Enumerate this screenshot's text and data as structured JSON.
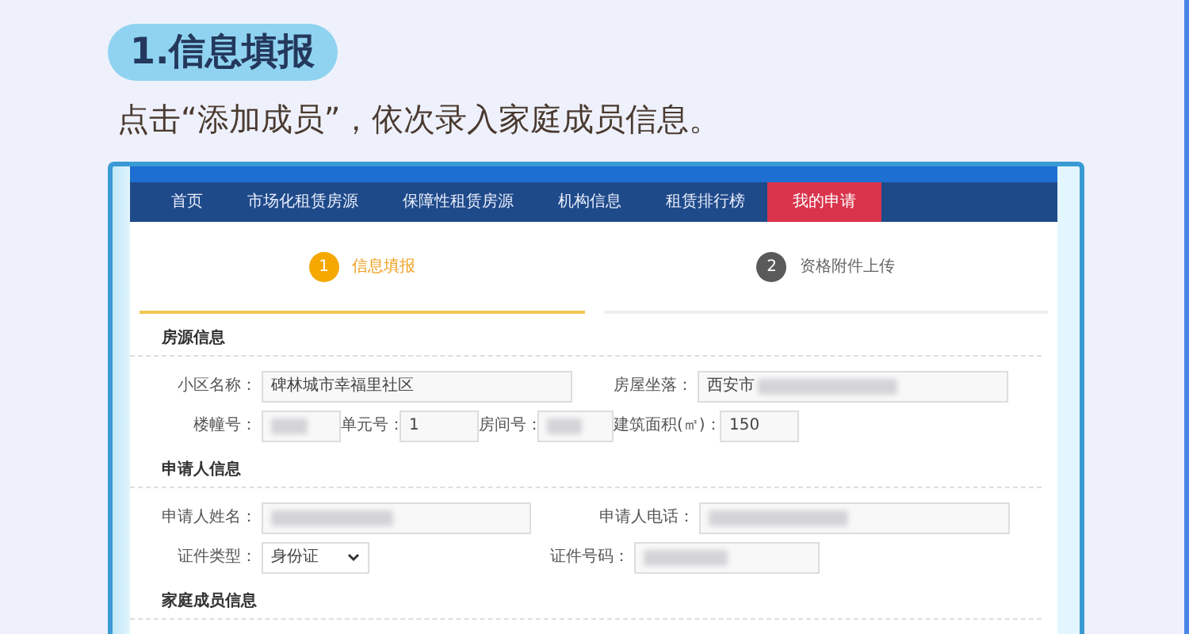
{
  "heading": {
    "label": "1.信息填报"
  },
  "instruction": "点击“添加成员”，依次录入家庭成员信息。",
  "nav": [
    {
      "label": "首页",
      "selected": false
    },
    {
      "label": "市场化租赁房源",
      "selected": false
    },
    {
      "label": "保障性租赁房源",
      "selected": false
    },
    {
      "label": "机构信息",
      "selected": false
    },
    {
      "label": "租赁排行榜",
      "selected": false
    },
    {
      "label": "我的申请",
      "selected": true
    }
  ],
  "steps": [
    {
      "number": "1",
      "label": "信息填报",
      "selected": true
    },
    {
      "number": "2",
      "label": "资格附件上传",
      "selected": false
    }
  ],
  "sections": [
    {
      "title": "房源信息",
      "fields": [
        {
          "label": "小区名称：",
          "kind": "text",
          "value": "碑林城市幸福里社区",
          "redacted": false
        },
        {
          "label": "房屋坐落：",
          "kind": "text",
          "value": "西安市",
          "redacted": true
        },
        {
          "label": "楼幢号：",
          "kind": "text",
          "redacted": true
        },
        {
          "label": "单元号：",
          "kind": "text",
          "value": "1",
          "redacted": false
        },
        {
          "label": "房间号：",
          "kind": "text",
          "redacted": true
        },
        {
          "label": "建筑面积(㎡)：",
          "kind": "text",
          "value": "150",
          "redacted": false
        }
      ]
    },
    {
      "title": "申请人信息",
      "fields": [
        {
          "label": "申请人姓名：",
          "kind": "text",
          "redacted": true
        },
        {
          "label": "申请人电话：",
          "kind": "text",
          "redacted": true
        },
        {
          "label": "证件类型：",
          "kind": "select",
          "value": "身份证",
          "redacted": false
        },
        {
          "label": "证件号码：",
          "kind": "text",
          "redacted": true
        }
      ]
    },
    {
      "title": "家庭成员信息"
    }
  ]
}
